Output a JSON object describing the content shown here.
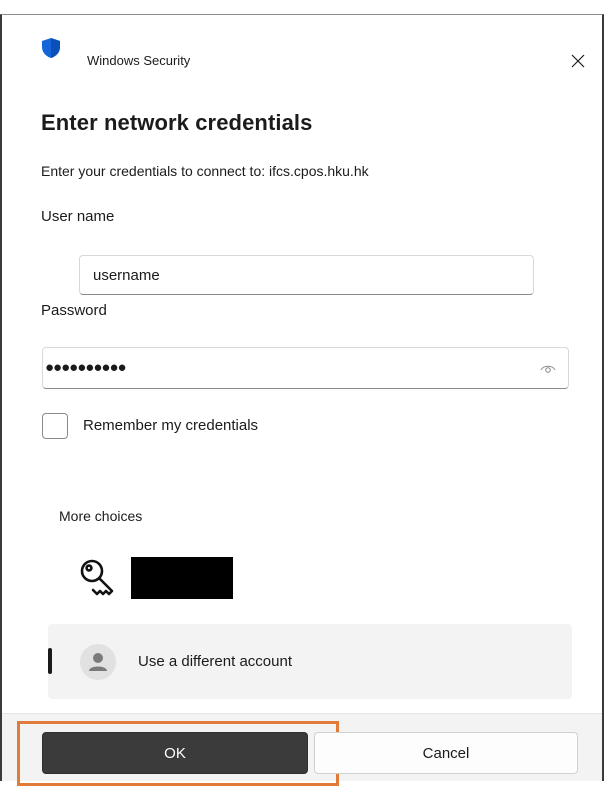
{
  "window": {
    "app_title": "Windows Security",
    "close_icon": "close-icon",
    "app_icon": "shield-icon"
  },
  "form": {
    "heading": "Enter network credentials",
    "subtitle": "Enter your credentials to connect to: ifcs.cpos.hku.hk",
    "username_label": "User name",
    "username_value": "username",
    "password_label": "Password",
    "password_value": "●●●●●●●●●●",
    "remember_label": "Remember my credentials",
    "remember_checked": false
  },
  "choices": {
    "more_choices_label": "More choices",
    "stored_account_icon": "key-icon",
    "different_account_label": "Use a different account"
  },
  "buttons": {
    "ok_label": "OK",
    "cancel_label": "Cancel"
  },
  "colors": {
    "shield_blue": "#1a73e8",
    "focus_highlight": "#e07b39",
    "ok_button": "#3b3b3b"
  }
}
